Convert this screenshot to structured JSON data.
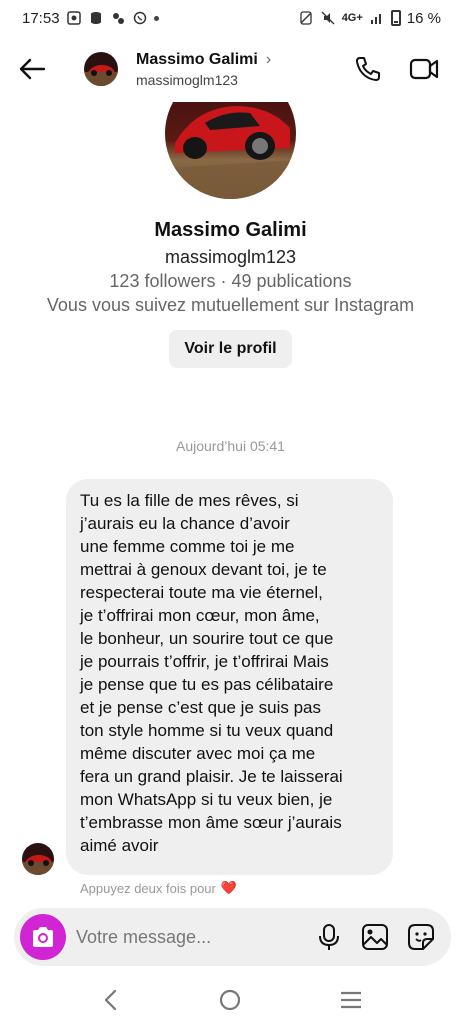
{
  "status_bar": {
    "time": "17:53",
    "network": "4G+",
    "battery": "16 %"
  },
  "header": {
    "name": "Massimo Galimi",
    "username": "massimoglm123",
    "chevron": "›"
  },
  "profile": {
    "name": "Massimo Galimi",
    "username": "massimoglm123",
    "stats": "123 followers · 49 publications",
    "mutual": "Vous vous suivez mutuellement sur Instagram",
    "view_profile_label": "Voir le profil"
  },
  "chat": {
    "timestamp": "Aujourd’hui 05:41",
    "message_lines": [
      "Tu es la fille de mes rêves, si",
      "j’aurais eu la chance d’avoir",
      "une femme comme toi je me",
      "mettrai à genoux devant toi, je te",
      "respecterai toute ma vie éternel,",
      "je t’offrirai mon cœur, mon âme,",
      "le bonheur, un sourire tout ce que",
      "je pourrais t’offrir, je t’offrirai Mais",
      "je pense que tu es pas célibataire",
      "et je pense c’est que je suis pas",
      "ton style homme si tu veux quand",
      "même discuter avec moi ça me",
      "fera un grand plaisir. Je te laisserai",
      "mon WhatsApp si tu veux bien, je",
      "t’embrasse mon âme sœur j’aurais",
      "aimé avoir"
    ],
    "double_tap_hint": "Appuyez deux fois pour",
    "heart": "❤️"
  },
  "composer": {
    "placeholder": "Votre message..."
  },
  "colors": {
    "accent": "#d024d5",
    "bubble": "#efefef",
    "muted_text": "#666666"
  },
  "icons": {
    "back": "back-arrow-icon",
    "call": "phone-icon",
    "video": "video-camera-icon",
    "camera": "camera-icon",
    "mic": "microphone-icon",
    "gallery": "image-icon",
    "sticker": "sticker-icon"
  }
}
